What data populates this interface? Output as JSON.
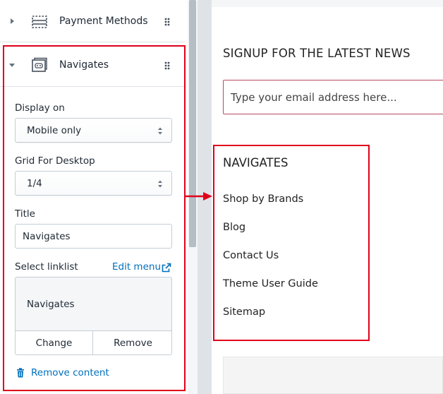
{
  "sidebar": {
    "sections": [
      {
        "label": "Payment Methods",
        "expanded": false,
        "icon": "footer-block-icon"
      },
      {
        "label": "Navigates",
        "expanded": true,
        "icon": "menu-block-icon"
      }
    ],
    "settings": {
      "display_on": {
        "label": "Display on",
        "value": "Mobile only"
      },
      "grid_desktop": {
        "label": "Grid For Desktop",
        "value": "1/4"
      },
      "title": {
        "label": "Title",
        "value": "Navigates"
      },
      "linklist": {
        "label": "Select linklist",
        "edit_link": "Edit menu",
        "selected": "Navigates",
        "change_button": "Change",
        "remove_button": "Remove"
      },
      "remove_content": "Remove content"
    }
  },
  "preview": {
    "newsletter_heading": "SIGNUP FOR THE LATEST NEWS",
    "email_placeholder": "Type your email address here...",
    "nav_heading": "NAVIGATES",
    "nav_links": [
      "Shop by Brands",
      "Blog",
      "Contact Us",
      "Theme User Guide",
      "Sitemap"
    ]
  },
  "colors": {
    "annotation_red": "#e0001a",
    "link_blue": "#006fbb",
    "email_border": "#b74b5e"
  }
}
